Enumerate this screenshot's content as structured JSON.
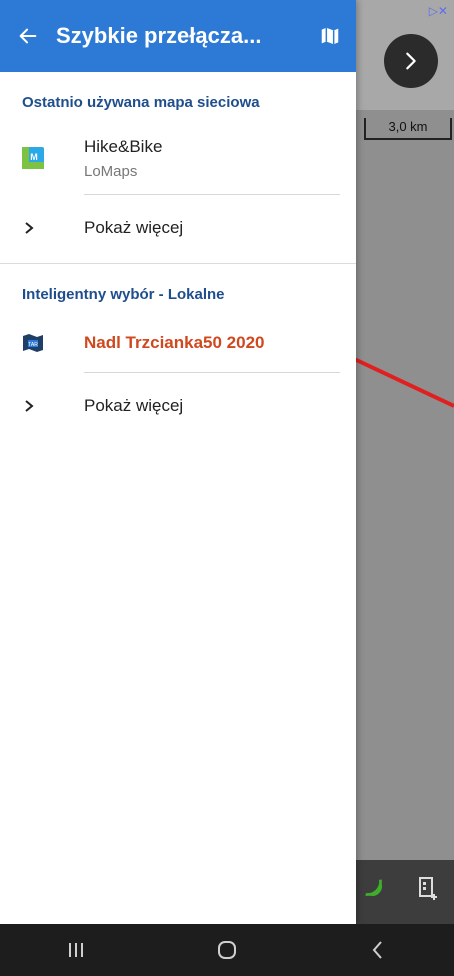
{
  "colors": {
    "header_bg": "#2d7ad6",
    "section_title": "#1f4e8c",
    "highlight": "#d0481e",
    "arrow": "#e02020"
  },
  "header": {
    "title": "Szybkie przełącza...",
    "back_icon": "arrow-left-icon",
    "map_icon": "map-icon"
  },
  "sections": [
    {
      "title": "Ostatnio używana mapa sieciowa",
      "items": [
        {
          "title": "Hike&Bike",
          "subtitle": "LoMaps",
          "icon": "lomaps-icon"
        }
      ],
      "show_more": "Pokaż więcej"
    },
    {
      "title": "Inteligentny wybór - Lokalne",
      "items": [
        {
          "title": "Nadl Trzcianka50 2020",
          "icon": "offline-map-icon"
        }
      ],
      "show_more": "Pokaż więcej"
    }
  ],
  "map": {
    "scale_label": "3,0 km"
  }
}
